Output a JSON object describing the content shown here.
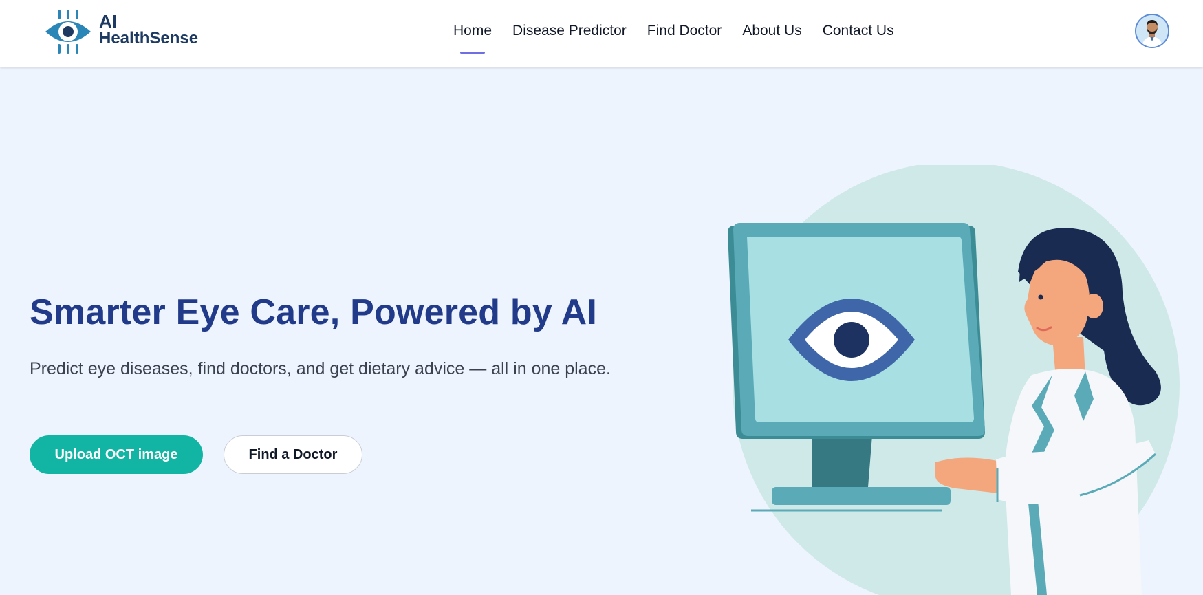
{
  "brand": {
    "line1": "AI",
    "line2": "HealthSense",
    "icon": "eye-chip-logo"
  },
  "nav": {
    "items": [
      {
        "label": "Home",
        "active": true
      },
      {
        "label": "Disease Predictor",
        "active": false
      },
      {
        "label": "Find Doctor",
        "active": false
      },
      {
        "label": "About Us",
        "active": false
      },
      {
        "label": "Contact Us",
        "active": false
      }
    ],
    "active_underline_color": "#6f6fe3"
  },
  "profile": {
    "icon": "user-avatar"
  },
  "hero": {
    "title": "Smarter Eye Care, Powered by AI",
    "subtitle": "Predict eye diseases, find doctors, and get dietary advice — all in one place.",
    "primary_button": "Upload OCT image",
    "secondary_button": "Find a Doctor",
    "illustration": "doctor-at-monitor-with-eye-illustration"
  },
  "colors": {
    "title": "#213b8a",
    "primary_button": "#12b5a3",
    "background": "#eef4fd",
    "brand_text": "#1d3a63"
  }
}
